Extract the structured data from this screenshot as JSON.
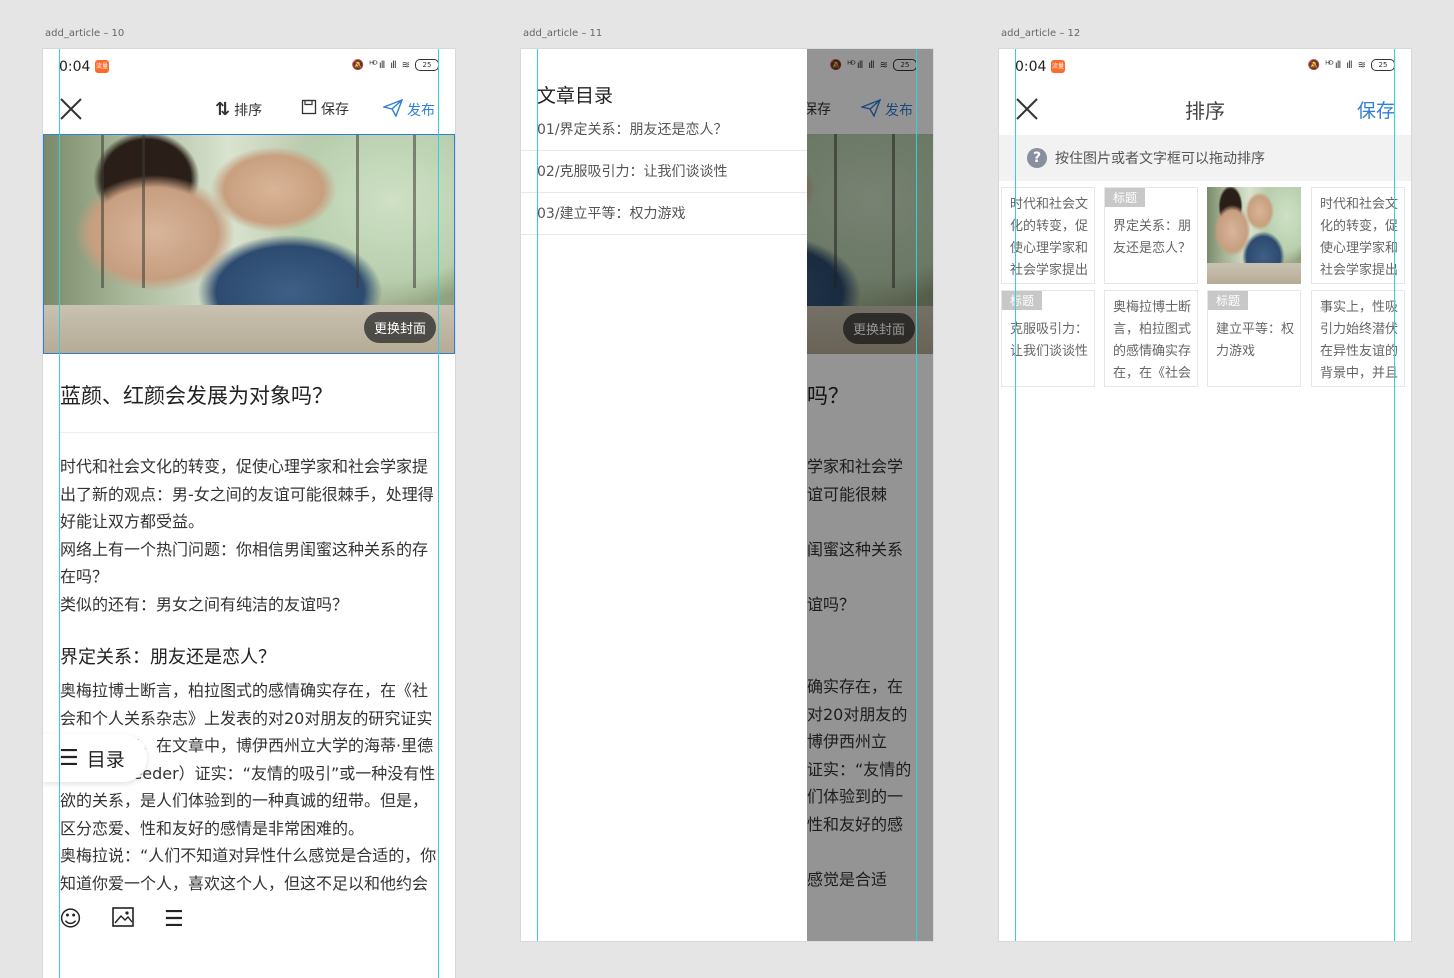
{
  "artboards": [
    {
      "label": "add_article – 10"
    },
    {
      "label": "add_article – 11"
    },
    {
      "label": "add_article – 12"
    }
  ],
  "status": {
    "time": "0:04",
    "badge": "流量",
    "battery": "25",
    "signal1": "ᴴᴰ ıll",
    "signal2": "ıll",
    "wifi": "≋",
    "mute": "🔕"
  },
  "editor": {
    "sort_label": "排序",
    "save_label": "保存",
    "publish_label": "发布",
    "change_cover": "更换封面",
    "title": "蓝颜、红颜会发展为对象吗？",
    "intro": [
      "时代和社会文化的转变，促使心理学家和社会学家提出了新的观点：男-女之间的友谊可能很棘手，处理得好能让双方都受益。",
      "网络上有一个热门问题：你相信男闺蜜这种关系的存在吗？",
      "类似的还有：男女之间有纯洁的友谊吗？"
    ],
    "section1_title": "界定关系：朋友还是恋人？",
    "section1_body": "奥梅拉博士断言，柏拉图式的感情确实存在，在《社会和个人关系杂志》上发表的对20对朋友的研究证实了这一观点。在文章中，博伊西州立大学的海蒂·里德（Heidi Reeder）证实：“友情的吸引”或一种没有性欲的关系，是人们体验到的一种真诚的纽带。但是，区分恋爱、性和友好的感情是非常困难的。",
    "section1_body2": "奥梅拉说：“人们不知道对异性什么感觉是合适的，你知道你爱一个人，喜欢这个人，但这不足以和他约会或结婚。这意味着什么？”",
    "toc_button": "目录",
    "drawer_lines": [
      "学家和社会学",
      "谊可能很棘",
      "闺蜜这种关系",
      "谊吗？",
      "确实存在，在",
      "对20对朋友的",
      "博伊西州立",
      "证实：“友情的",
      "们体验到的一",
      "性和友好的感",
      "感觉是合适"
    ]
  },
  "toc": {
    "title": "文章目录",
    "items": [
      "01/界定关系：朋友还是恋人？",
      "02/克服吸引力：让我们谈谈性",
      "03/建立平等：权力游戏"
    ]
  },
  "sorter": {
    "title": "排序",
    "save_label": "保存",
    "tip": "按住图片或者文字框可以拖动排序",
    "tag_label": "标题",
    "cards": [
      {
        "type": "text",
        "text": "时代和社会文化的转变，促使心理学家和社会学家提出"
      },
      {
        "type": "title",
        "text": "界定关系：朋友还是恋人？"
      },
      {
        "type": "image"
      },
      {
        "type": "text",
        "text": "时代和社会文化的转变，促使心理学家和社会学家提出"
      },
      {
        "type": "title",
        "text": "克服吸引力：让我们谈谈性"
      },
      {
        "type": "text",
        "text": "奥梅拉博士断言，柏拉图式的感情确实存在，在《社会"
      },
      {
        "type": "title",
        "text": "建立平等：权力游戏"
      },
      {
        "type": "text",
        "text": "事实上，性吸引力始终潜伏在异性友谊的背景中，并且"
      }
    ]
  }
}
